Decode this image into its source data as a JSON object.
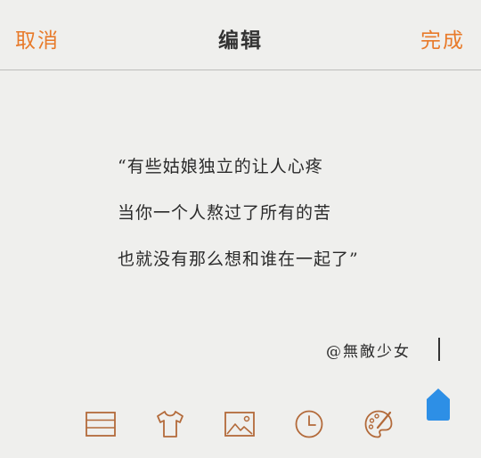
{
  "header": {
    "cancel_label": "取消",
    "title": "编辑",
    "done_label": "完成"
  },
  "content": {
    "quote_lines": [
      "“有些姑娘独立的让人心疼",
      "当你一个人熬过了所有的苦",
      "也就没有那么想和谁在一起了”"
    ],
    "signature": "@無敵少女"
  },
  "toolbar": {
    "icons": [
      "text-lines-icon",
      "tshirt-icon",
      "image-icon",
      "clock-icon",
      "palette-icon"
    ]
  },
  "colors": {
    "accent": "#e87a2a",
    "icon_brown": "#b36a3a",
    "pin_blue": "#2d8fe6",
    "background": "#efefed"
  }
}
